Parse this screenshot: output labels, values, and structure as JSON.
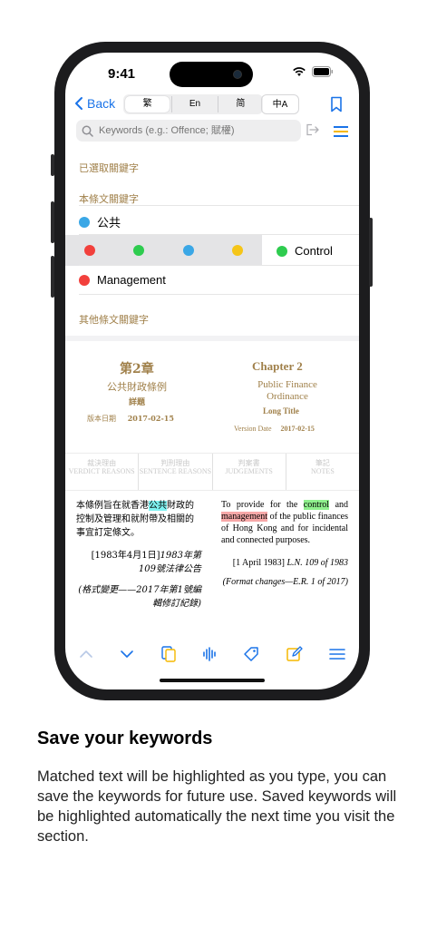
{
  "status": {
    "time": "9:41"
  },
  "nav": {
    "back_label": "Back",
    "segments": [
      "繁",
      "En",
      "简"
    ],
    "selected_segment": "繁",
    "translate_label": "中A"
  },
  "search": {
    "placeholder": "Keywords (e.g.: Offence; 賦權)"
  },
  "keywords": {
    "selected_heading": "已選取關鍵字",
    "section_heading": "本條文關鍵字",
    "items": [
      {
        "label": "公共",
        "color": "#3aa7e6"
      },
      {
        "label": "Control",
        "color": "#2ecc4f"
      },
      {
        "label": "Management",
        "color": "#f2403c"
      }
    ],
    "color_options": [
      "#f2403c",
      "#2ecc4f",
      "#3aa7e6",
      "#f5c518"
    ],
    "other_heading": "其他條文關鍵字"
  },
  "header": {
    "chapter_zh": "第2章",
    "chapter_en": "Chapter 2",
    "ordinance_zh": "公共財政條例",
    "ordinance_en": "Public Finance Ordinance",
    "long_title_zh": "詳題",
    "long_title_en": "Long Title",
    "version_label_zh": "版本日期",
    "version_label_en": "Version Date",
    "version_date": "2017-02-15"
  },
  "tabs": [
    {
      "zh": "裁決理由",
      "en": "VERDICT REASONS"
    },
    {
      "zh": "判刑理由",
      "en": "SENTENCE REASONS"
    },
    {
      "zh": "判案書",
      "en": "JUDGEMENTS"
    },
    {
      "zh": "筆記",
      "en": "NOTES"
    }
  ],
  "body_zh": {
    "pre": "本條例旨在就香港",
    "hl": "公共",
    "post": "財政的控制及管理和就附帶及相關的事宜訂定條文。",
    "ref_a": "[1983年4月1日]",
    "ref_b": "1983年第109號法律公告",
    "format": "(格式變更——2017年第1號編輯修訂紀錄)"
  },
  "body_en": {
    "pre": "To provide for the",
    "hl1": "control",
    "mid": "and",
    "hl2": "management",
    "post": "of the public finances of Hong Kong and for incidental and connected purposes.",
    "ref_a": "[1 April 1983]",
    "ref_b": "L.N. 109 of 1983",
    "format": "(Format changes—E.R. 1 of 2017)"
  },
  "toolbar_icons": [
    "chevron-up-icon",
    "chevron-down-icon",
    "copy-icon",
    "waveform-icon",
    "tag-icon",
    "edit-icon",
    "menu-icon"
  ],
  "caption": {
    "title": "Save your keywords",
    "body": "Matched text will be highlighted as you type, you can save the keywords for future use.  Saved keywords will be highlighted automatically the next time you visit the section."
  },
  "colors": {
    "accent": "#1a73e8",
    "gold": "#a0804a",
    "toolbar_yellow": "#f5b800"
  }
}
